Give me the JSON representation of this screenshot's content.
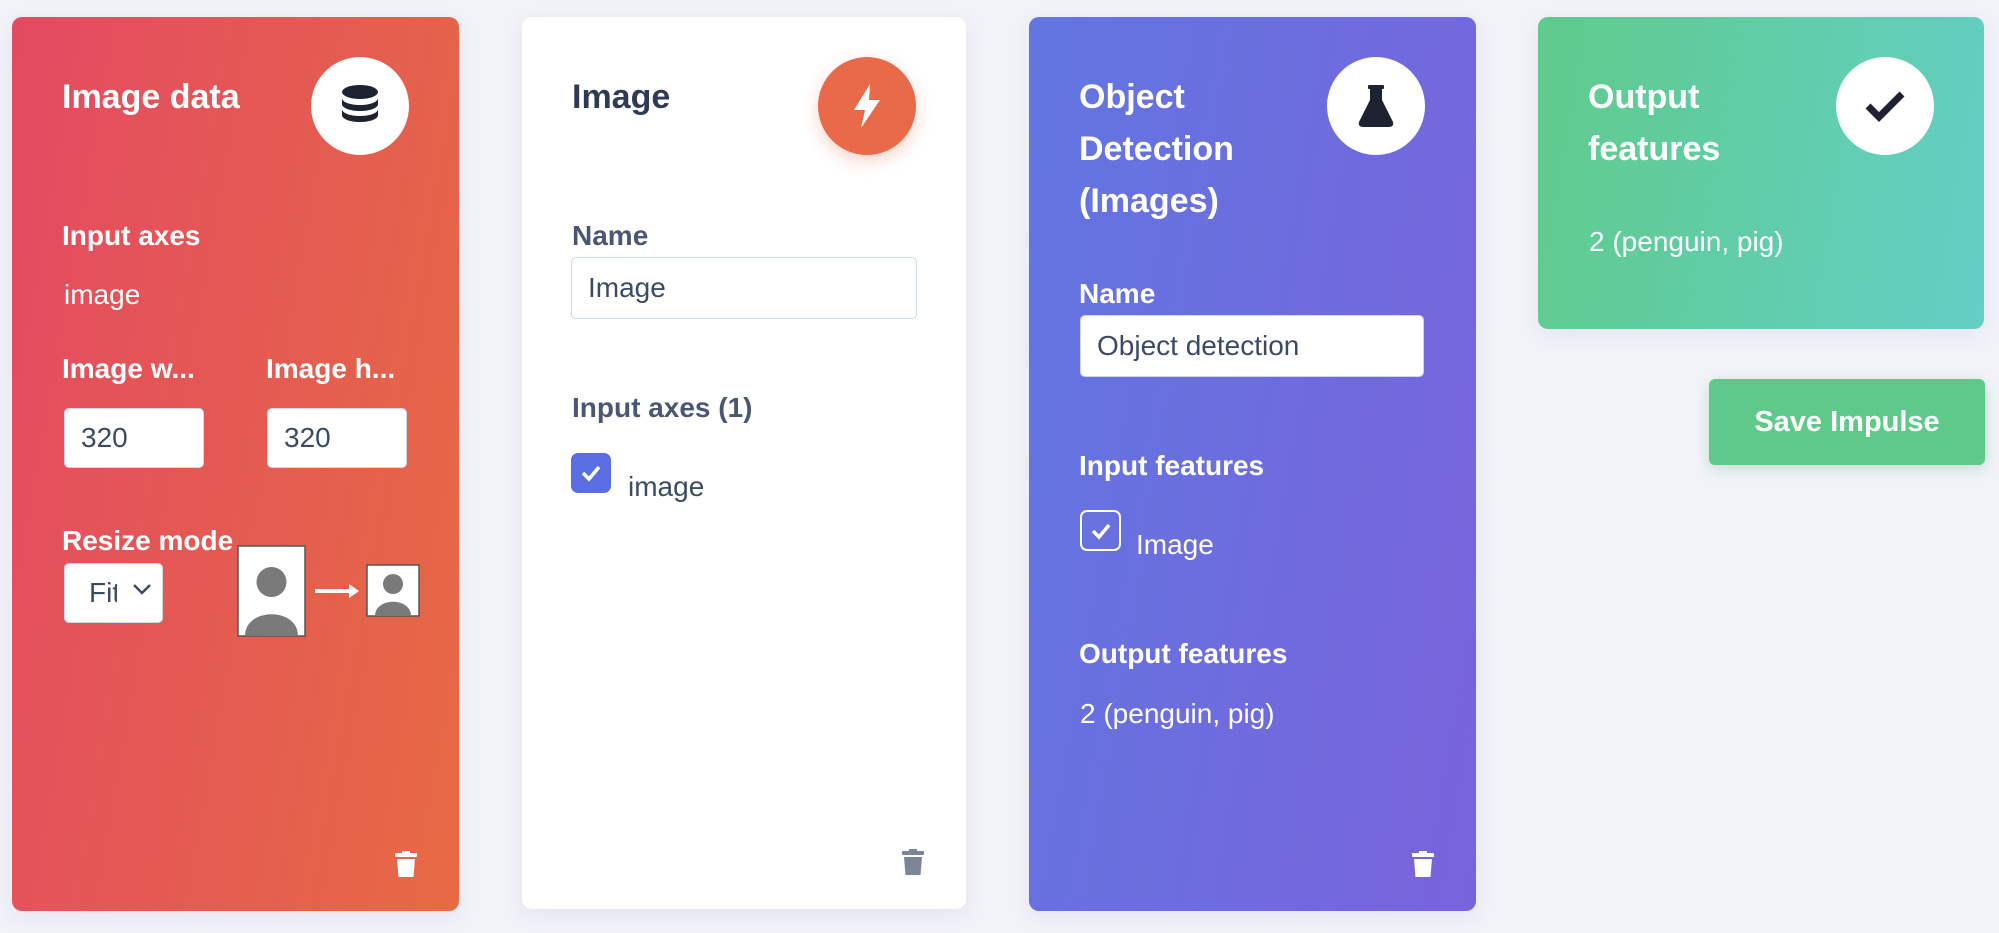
{
  "image_data_block": {
    "title": "Image data",
    "icon": "database-icon",
    "input_axes_label": "Input axes",
    "input_axes_value": "image",
    "width_label": "Image w...",
    "height_label": "Image h...",
    "width_value": "320",
    "height_value": "320",
    "resize_mode_label": "Resize mode",
    "resize_mode_value": "Fit shortest axis"
  },
  "processing_block": {
    "title": "Image",
    "icon": "lightning-icon",
    "name_label": "Name",
    "name_value": "Image",
    "input_axes_label": "Input axes (1)",
    "axis_option": "image",
    "axis_checked": true
  },
  "learning_block": {
    "title": "Object Detection (Images)",
    "icon": "flask-icon",
    "name_label": "Name",
    "name_value": "Object detection",
    "input_features_label": "Input features",
    "input_feature_option": "Image",
    "input_feature_checked": true,
    "output_features_label": "Output features",
    "output_features_value": "2 (penguin, pig)"
  },
  "output_block": {
    "title": "Output features",
    "icon": "checkmark-icon",
    "value": "2 (penguin, pig)"
  },
  "save_button_label": "Save Impulse",
  "colors": {
    "red_block": "#e34a62",
    "orange_accent": "#e96a48",
    "purple_block": "#6a6fe0",
    "green_block": "#5fcb8b",
    "checkbox_blue": "#5b6ee1"
  }
}
